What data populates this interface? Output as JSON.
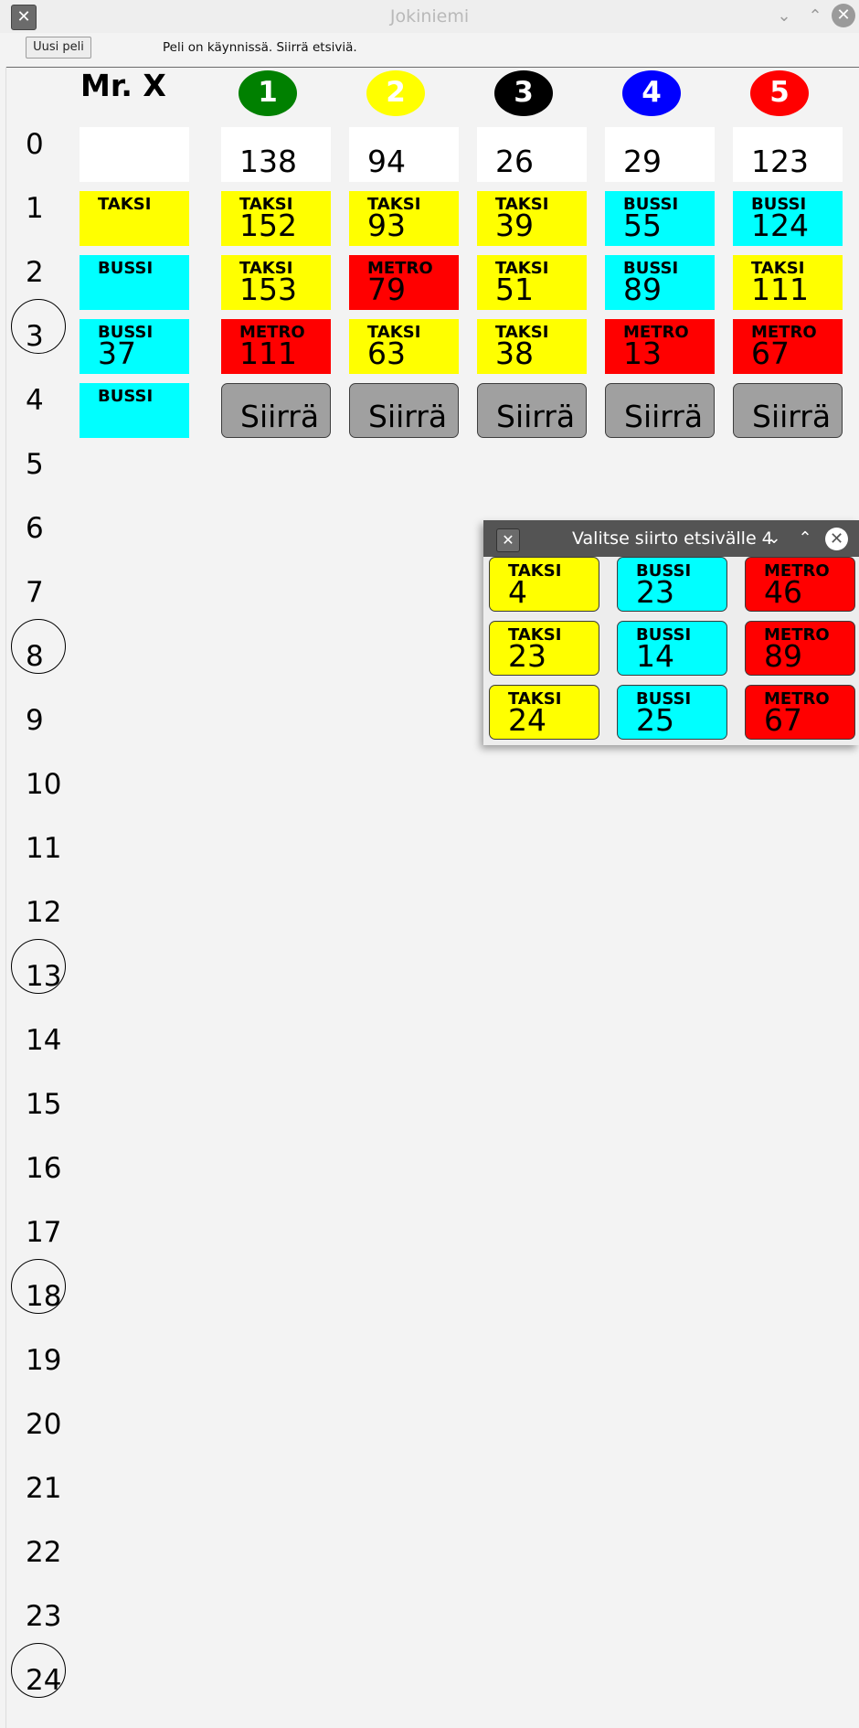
{
  "window": {
    "title": "Jokiniemi",
    "icon": "x-app-icon"
  },
  "toolbar": {
    "new_game_label": "Uusi peli",
    "status": "Peli on käynnissä. Siirrä etsiviä."
  },
  "mrx": {
    "header": "Mr. X"
  },
  "detectives": [
    {
      "label": "1",
      "color": "#008000"
    },
    {
      "label": "2",
      "color": "#ffff00"
    },
    {
      "label": "3",
      "color": "#000000"
    },
    {
      "label": "4",
      "color": "#0000ff"
    },
    {
      "label": "5",
      "color": "#ff0000"
    }
  ],
  "rounds": [
    "0",
    "1",
    "2",
    "3",
    "4",
    "5",
    "6",
    "7",
    "8",
    "9",
    "10",
    "11",
    "12",
    "13",
    "14",
    "15",
    "16",
    "17",
    "18",
    "19",
    "20",
    "21",
    "22",
    "23",
    "24"
  ],
  "reveal_rounds": [
    "3",
    "8",
    "13",
    "18",
    "24"
  ],
  "mrx_moves": [
    {
      "ticket": "",
      "node": "",
      "color": "#ffffff"
    },
    {
      "ticket": "TAKSI",
      "node": "",
      "color": "#ffff00"
    },
    {
      "ticket": "BUSSI",
      "node": "",
      "color": "#00ffff"
    },
    {
      "ticket": "BUSSI",
      "node": "37",
      "color": "#00ffff"
    },
    {
      "ticket": "BUSSI",
      "node": "",
      "color": "#00ffff"
    }
  ],
  "detective_moves": [
    [
      {
        "ticket": "",
        "node": "138",
        "color": "#ffffff"
      },
      {
        "ticket": "TAKSI",
        "node": "152",
        "color": "#ffff00"
      },
      {
        "ticket": "TAKSI",
        "node": "153",
        "color": "#ffff00"
      },
      {
        "ticket": "METRO",
        "node": "111",
        "color": "#ff0000"
      }
    ],
    [
      {
        "ticket": "",
        "node": "94",
        "color": "#ffffff"
      },
      {
        "ticket": "TAKSI",
        "node": "93",
        "color": "#ffff00"
      },
      {
        "ticket": "METRO",
        "node": "79",
        "color": "#ff0000"
      },
      {
        "ticket": "TAKSI",
        "node": "63",
        "color": "#ffff00"
      }
    ],
    [
      {
        "ticket": "",
        "node": "26",
        "color": "#ffffff"
      },
      {
        "ticket": "TAKSI",
        "node": "39",
        "color": "#ffff00"
      },
      {
        "ticket": "TAKSI",
        "node": "51",
        "color": "#ffff00"
      },
      {
        "ticket": "TAKSI",
        "node": "38",
        "color": "#ffff00"
      }
    ],
    [
      {
        "ticket": "",
        "node": "29",
        "color": "#ffffff"
      },
      {
        "ticket": "BUSSI",
        "node": "55",
        "color": "#00ffff"
      },
      {
        "ticket": "BUSSI",
        "node": "89",
        "color": "#00ffff"
      },
      {
        "ticket": "METRO",
        "node": "13",
        "color": "#ff0000"
      }
    ],
    [
      {
        "ticket": "",
        "node": "123",
        "color": "#ffffff"
      },
      {
        "ticket": "BUSSI",
        "node": "124",
        "color": "#00ffff"
      },
      {
        "ticket": "TAKSI",
        "node": "111",
        "color": "#ffff00"
      },
      {
        "ticket": "METRO",
        "node": "67",
        "color": "#ff0000"
      }
    ]
  ],
  "move_button_label": "Siirrä",
  "dialog": {
    "title": "Valitse siirto etsivälle 4",
    "options": [
      [
        {
          "ticket": "TAKSI",
          "node": "4",
          "color": "#ffff00"
        },
        {
          "ticket": "BUSSI",
          "node": "23",
          "color": "#00ffff"
        },
        {
          "ticket": "METRO",
          "node": "46",
          "color": "#ff0000"
        }
      ],
      [
        {
          "ticket": "TAKSI",
          "node": "23",
          "color": "#ffff00"
        },
        {
          "ticket": "BUSSI",
          "node": "14",
          "color": "#00ffff"
        },
        {
          "ticket": "METRO",
          "node": "89",
          "color": "#ff0000"
        }
      ],
      [
        {
          "ticket": "TAKSI",
          "node": "24",
          "color": "#ffff00"
        },
        {
          "ticket": "BUSSI",
          "node": "25",
          "color": "#00ffff"
        },
        {
          "ticket": "METRO",
          "node": "67",
          "color": "#ff0000"
        }
      ]
    ]
  }
}
